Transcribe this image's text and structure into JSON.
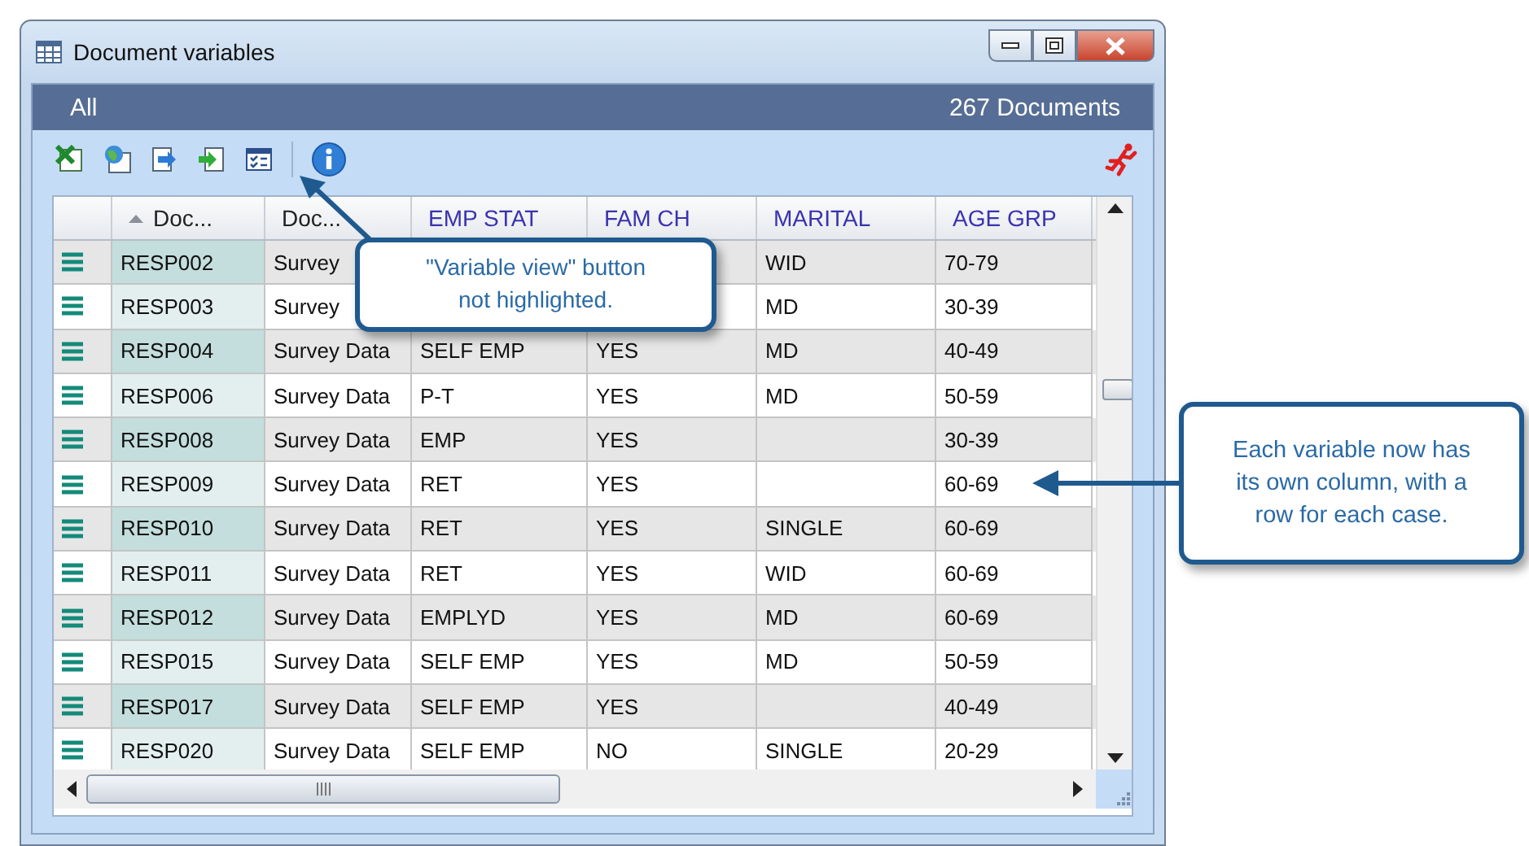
{
  "window": {
    "title": "Document variables"
  },
  "filter_bar": {
    "scope": "All",
    "count": "267 Documents"
  },
  "toolbar": [
    {
      "kind": "spreadsheet",
      "highlighted": false
    },
    {
      "kind": "globe",
      "highlighted": false
    },
    {
      "kind": "export",
      "highlighted": false
    },
    {
      "kind": "import",
      "highlighted": false
    },
    {
      "kind": "variable-view",
      "highlighted": false
    },
    {
      "kind": "separator"
    },
    {
      "kind": "info",
      "highlighted": false
    },
    {
      "kind": "runner",
      "highlighted": false
    }
  ],
  "columns": [
    {
      "label": "Doc...",
      "kind": "field",
      "sorted": true
    },
    {
      "label": "Doc...",
      "kind": "field",
      "sorted": false
    },
    {
      "label": "EMP STAT",
      "kind": "variable",
      "sorted": false
    },
    {
      "label": "FAM CH",
      "kind": "variable",
      "sorted": false
    },
    {
      "label": "MARITAL",
      "kind": "variable",
      "sorted": false
    },
    {
      "label": "AGE GRP",
      "kind": "variable",
      "sorted": false
    }
  ],
  "rows": [
    {
      "doc": "RESP002",
      "type": "Survey",
      "fam_ch": null,
      "marital": "WID",
      "age_grp": "70-79"
    },
    {
      "doc": "RESP003",
      "type": "Survey",
      "fam_ch": null,
      "marital": "MD",
      "age_grp": "30-39"
    },
    {
      "doc": "RESP004",
      "type": "Survey Data",
      "emp_stat": "SELF EMP",
      "fam_ch": "YES",
      "marital": "MD",
      "age_grp": "40-49"
    },
    {
      "doc": "RESP006",
      "type": "Survey Data",
      "emp_stat": "P-T",
      "fam_ch": "YES",
      "marital": "MD",
      "age_grp": "50-59"
    },
    {
      "doc": "RESP008",
      "type": "Survey Data",
      "emp_stat": "EMP",
      "fam_ch": "YES",
      "marital": null,
      "age_grp": "30-39"
    },
    {
      "doc": "RESP009",
      "type": "Survey Data",
      "emp_stat": "RET",
      "fam_ch": "YES",
      "marital": null,
      "age_grp": "60-69"
    },
    {
      "doc": "RESP010",
      "type": "Survey Data",
      "emp_stat": "RET",
      "fam_ch": "YES",
      "marital": "SINGLE",
      "age_grp": "60-69"
    },
    {
      "doc": "RESP011",
      "type": "Survey Data",
      "emp_stat": "RET",
      "fam_ch": "YES",
      "marital": "WID",
      "age_grp": "60-69"
    },
    {
      "doc": "RESP012",
      "type": "Survey Data",
      "emp_stat": "EMPLYD",
      "fam_ch": "YES",
      "marital": "MD",
      "age_grp": "60-69"
    },
    {
      "doc": "RESP015",
      "type": "Survey Data",
      "emp_stat": "SELF EMP",
      "fam_ch": "YES",
      "marital": "MD",
      "age_grp": "50-59"
    },
    {
      "doc": "RESP017",
      "type": "Survey Data",
      "emp_stat": "SELF EMP",
      "fam_ch": "YES",
      "marital": null,
      "age_grp": "40-49"
    },
    {
      "doc": "RESP020",
      "type": "Survey Data",
      "emp_stat": "SELF EMP",
      "fam_ch": "NO",
      "marital": "SINGLE",
      "age_grp": "20-29"
    }
  ],
  "annotations": [
    {
      "text": "\"Variable view\" button not highlighted."
    },
    {
      "text": "Each variable now has its own column, with a row for each case."
    }
  ]
}
